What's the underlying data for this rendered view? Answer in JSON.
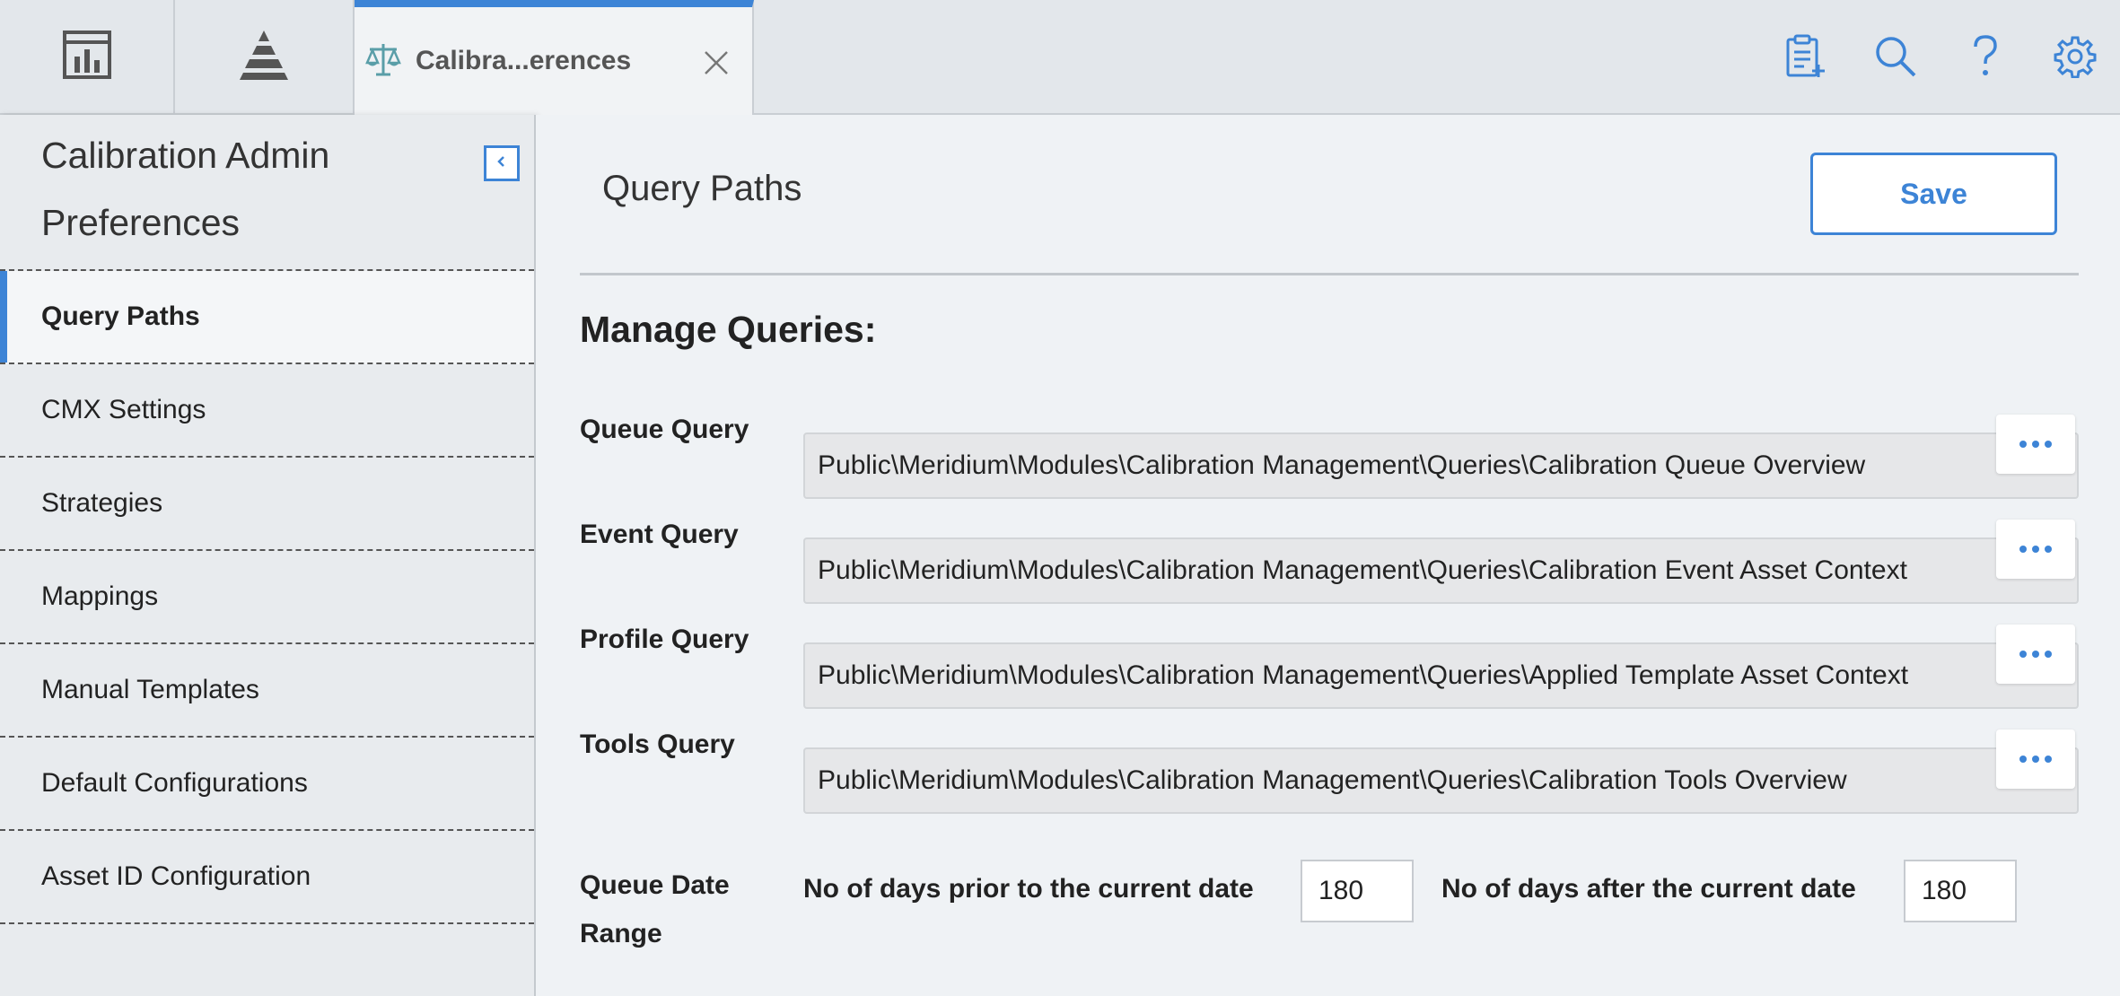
{
  "topbar": {
    "active_tab_label": "Calibra...erences",
    "icons": [
      "dashboard-icon",
      "pyramid-icon",
      "calibration-scale-icon",
      "close-icon",
      "new-clipboard-icon",
      "search-icon",
      "help-icon",
      "gear-icon"
    ],
    "accent": "#3d84d6"
  },
  "sidebar": {
    "title": "Calibration Admin Preferences",
    "items": [
      {
        "label": "Query Paths",
        "active": true
      },
      {
        "label": "CMX Settings"
      },
      {
        "label": "Strategies"
      },
      {
        "label": "Mappings"
      },
      {
        "label": "Manual Templates"
      },
      {
        "label": "Default Configurations"
      },
      {
        "label": "Asset ID Configuration"
      }
    ]
  },
  "main": {
    "title": "Query Paths",
    "save_label": "Save",
    "section_heading": "Manage Queries:",
    "queries": [
      {
        "label": "Queue Query",
        "value": "Public\\Meridium\\Modules\\Calibration Management\\Queries\\Calibration Queue Overview"
      },
      {
        "label": "Event Query",
        "value": "Public\\Meridium\\Modules\\Calibration Management\\Queries\\Calibration Event Asset Context"
      },
      {
        "label": "Profile Query",
        "value": "Public\\Meridium\\Modules\\Calibration Management\\Queries\\Applied Template Asset Context"
      },
      {
        "label": "Tools Query",
        "value": "Public\\Meridium\\Modules\\Calibration Management\\Queries\\Calibration Tools Overview"
      }
    ],
    "queue_date_range": {
      "label": "Queue Date Range",
      "prior_label": "No of days prior to the current date",
      "prior_value": "180",
      "after_label": "No of days after the current date",
      "after_value": "180"
    }
  }
}
